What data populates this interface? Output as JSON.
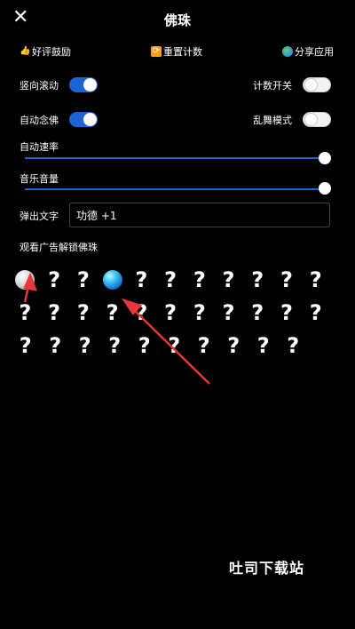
{
  "header": {
    "title": "佛珠",
    "close_icon": "close-icon"
  },
  "top_actions": {
    "rate": {
      "icon": "thumbs-up-icon",
      "label": "好评鼓励"
    },
    "reset": {
      "icon": "refresh-icon",
      "label": "重置计数"
    },
    "share": {
      "icon": "globe-icon",
      "label": "分享应用"
    }
  },
  "settings": {
    "vertical_scroll": {
      "label": "竖向滚动",
      "on": true
    },
    "count_switch": {
      "label": "计数开关",
      "on": false
    },
    "auto_chant": {
      "label": "自动念佛",
      "on": true
    },
    "chaos_mode": {
      "label": "乱舞模式",
      "on": false
    },
    "auto_speed": {
      "label": "自动速率",
      "value": 1.0
    },
    "music_volume": {
      "label": "音乐音量",
      "value": 1.0
    },
    "popup_text": {
      "label": "弹出文字",
      "value": "功德 +1"
    }
  },
  "beads": {
    "section_label": "观看广告解锁佛珠",
    "unlocked_glyph": "",
    "locked_glyph": "?",
    "rows": [
      [
        "white",
        "?",
        "?",
        "blue",
        "?",
        "?",
        "?",
        "?",
        "?",
        "?",
        "?"
      ],
      [
        "?",
        "?",
        "?",
        "?",
        "?",
        "?",
        "?",
        "?",
        "?",
        "?",
        "?"
      ],
      [
        "?",
        "?",
        "?",
        "?",
        "?",
        "?",
        "?",
        "?",
        "?",
        "?"
      ]
    ]
  },
  "watermark": "吐司下载站",
  "colors": {
    "accent": "#1e63d6",
    "background": "#000000",
    "arrow": "#e8363b"
  }
}
